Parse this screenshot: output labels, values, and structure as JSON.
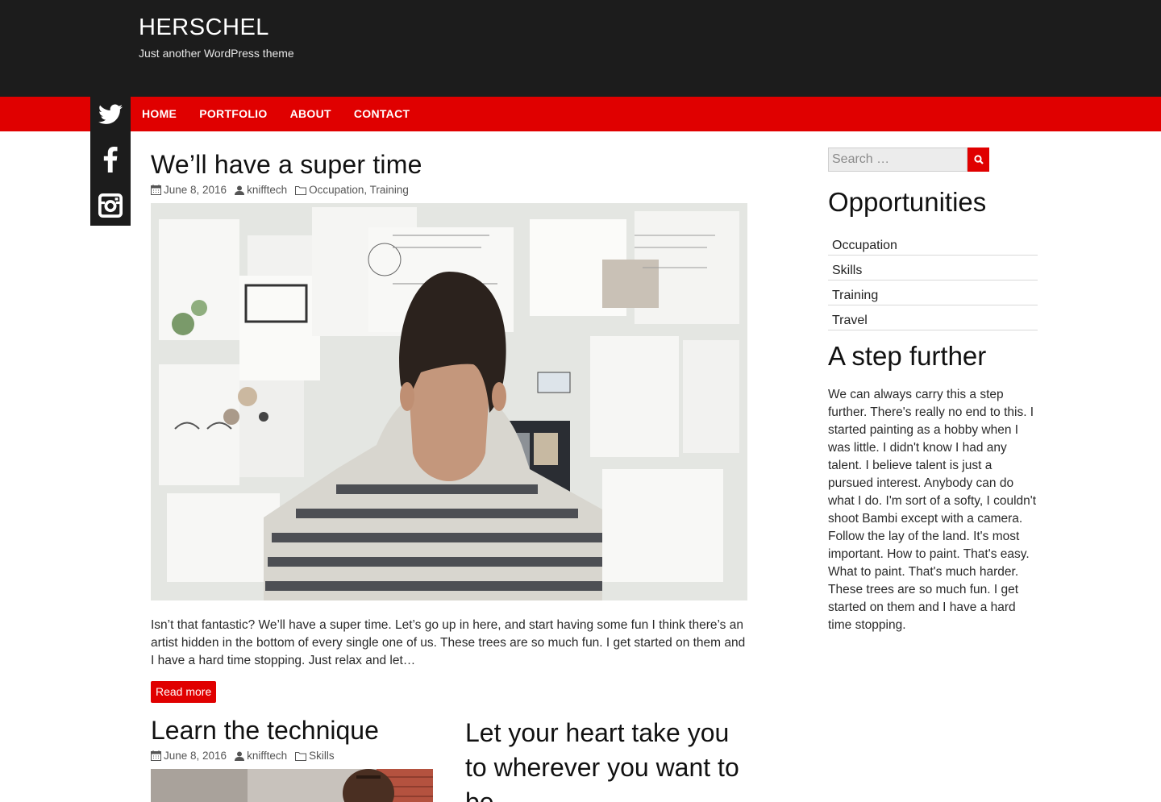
{
  "site": {
    "title": "HERSCHEL",
    "tagline": "Just another WordPress theme"
  },
  "nav": {
    "items": [
      {
        "label": "HOME"
      },
      {
        "label": "PORTFOLIO"
      },
      {
        "label": "ABOUT"
      },
      {
        "label": "CONTACT"
      }
    ]
  },
  "social": [
    "twitter-icon",
    "facebook-icon",
    "instagram-icon"
  ],
  "colors": {
    "accent": "#e00000",
    "header_bg": "#1c1c1c"
  },
  "main_post": {
    "title": "We’ll have a super time",
    "date": "June 8, 2016",
    "author": "knifftech",
    "categories": "Occupation, Training",
    "excerpt": "Isn’t that fantastic? We’ll have a super time. Let’s go up in here, and start having some fun I think there’s an artist hidden in the bottom of every single one of us. These trees are so much fun. I get started on them and I have a hard time stopping. Just relax and let…",
    "read_more": "Read more"
  },
  "posts": [
    {
      "title": "Learn the technique",
      "date": "June 8, 2016",
      "author": "knifftech",
      "categories": "Skills"
    },
    {
      "title": "Let your heart take you to wherever you want to be"
    }
  ],
  "sidebar": {
    "search_placeholder": "Search …",
    "widget1_title": "Opportunities",
    "categories": [
      "Occupation",
      "Skills",
      "Training",
      "Travel"
    ],
    "widget2_title": "A step further",
    "widget2_text": "We can always carry this a step further. There's really no end to this. I started painting as a hobby when I was little. I didn't know I had any talent. I believe talent is just a pursued interest. Anybody can do what I do. I'm sort of a softy, I couldn't shoot Bambi except with a camera. Follow the lay of the land. It's most important. How to paint. That's easy. What to paint. That's much harder. These trees are so much fun. I get started on them and I have a hard time stopping."
  }
}
